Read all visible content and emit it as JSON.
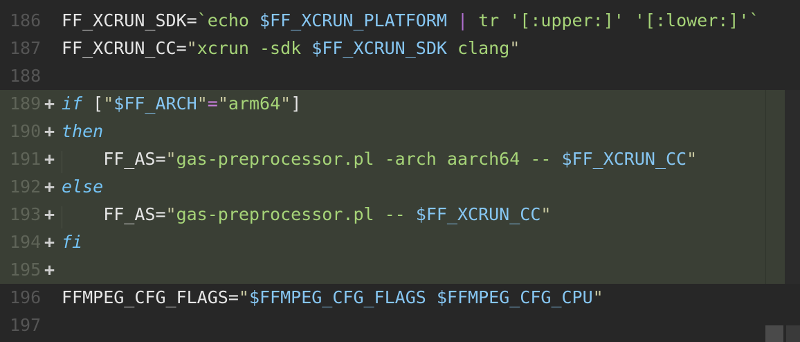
{
  "editor": {
    "lines": [
      {
        "num": "186",
        "added": false,
        "tokens": [
          {
            "t": "FF_XCRUN_SDK=",
            "c": "plain"
          },
          {
            "t": "`echo ",
            "c": "str"
          },
          {
            "t": "$FF_XCRUN_PLATFORM",
            "c": "var"
          },
          {
            "t": " ",
            "c": "plain"
          },
          {
            "t": "|",
            "c": "pipe"
          },
          {
            "t": " tr '[:upper:]' '[:lower:]'`",
            "c": "str"
          }
        ]
      },
      {
        "num": "187",
        "added": false,
        "tokens": [
          {
            "t": "FF_XCRUN_CC=",
            "c": "plain"
          },
          {
            "t": "\"",
            "c": "quote"
          },
          {
            "t": "xcrun -sdk ",
            "c": "str"
          },
          {
            "t": "$FF_XCRUN_SDK",
            "c": "var"
          },
          {
            "t": " clang",
            "c": "str"
          },
          {
            "t": "\"",
            "c": "quote"
          }
        ]
      },
      {
        "num": "188",
        "added": false,
        "tokens": []
      },
      {
        "num": "189",
        "added": true,
        "tokens": [
          {
            "t": "if",
            "c": "kw"
          },
          {
            "t": " [",
            "c": "plain"
          },
          {
            "t": "\"",
            "c": "quote"
          },
          {
            "t": "$FF_ARCH",
            "c": "var"
          },
          {
            "t": "\"",
            "c": "quote"
          },
          {
            "t": "=",
            "c": "op"
          },
          {
            "t": "\"",
            "c": "quote"
          },
          {
            "t": "arm64",
            "c": "str"
          },
          {
            "t": "\"",
            "c": "quote"
          },
          {
            "t": "]",
            "c": "plain"
          }
        ]
      },
      {
        "num": "190",
        "added": true,
        "tokens": [
          {
            "t": "then",
            "c": "kw"
          }
        ]
      },
      {
        "num": "191",
        "added": true,
        "indent": true,
        "tokens": [
          {
            "t": "    FF_AS=",
            "c": "plain"
          },
          {
            "t": "\"",
            "c": "quote"
          },
          {
            "t": "gas-preprocessor.pl -arch aarch64 -- ",
            "c": "str"
          },
          {
            "t": "$FF_XCRUN_CC",
            "c": "var"
          },
          {
            "t": "\"",
            "c": "quote"
          }
        ]
      },
      {
        "num": "192",
        "added": true,
        "tokens": [
          {
            "t": "else",
            "c": "kw"
          }
        ]
      },
      {
        "num": "193",
        "added": true,
        "indent": true,
        "tokens": [
          {
            "t": "    FF_AS=",
            "c": "plain"
          },
          {
            "t": "\"",
            "c": "quote"
          },
          {
            "t": "gas-preprocessor.pl -- ",
            "c": "str"
          },
          {
            "t": "$FF_XCRUN_CC",
            "c": "var"
          },
          {
            "t": "\"",
            "c": "quote"
          }
        ]
      },
      {
        "num": "194",
        "added": true,
        "tokens": [
          {
            "t": "fi",
            "c": "kw"
          }
        ]
      },
      {
        "num": "195",
        "added": true,
        "tokens": []
      },
      {
        "num": "196",
        "added": false,
        "tokens": [
          {
            "t": "FFMPEG_CFG_FLAGS=",
            "c": "plain"
          },
          {
            "t": "\"",
            "c": "quote"
          },
          {
            "t": "$FFMPEG_CFG_FLAGS",
            "c": "var"
          },
          {
            "t": " ",
            "c": "str"
          },
          {
            "t": "$FFMPEG_CFG_CPU",
            "c": "var"
          },
          {
            "t": "\"",
            "c": "quote"
          }
        ]
      },
      {
        "num": "197",
        "added": false,
        "tokens": []
      }
    ],
    "added_marker": "+"
  },
  "colors": {
    "background": "#272727",
    "added_background": "#3a3f35",
    "string": "#a6d478",
    "variable": "#86c6f2",
    "keyword": "#74c3f5",
    "operator": "#c77ddb"
  }
}
